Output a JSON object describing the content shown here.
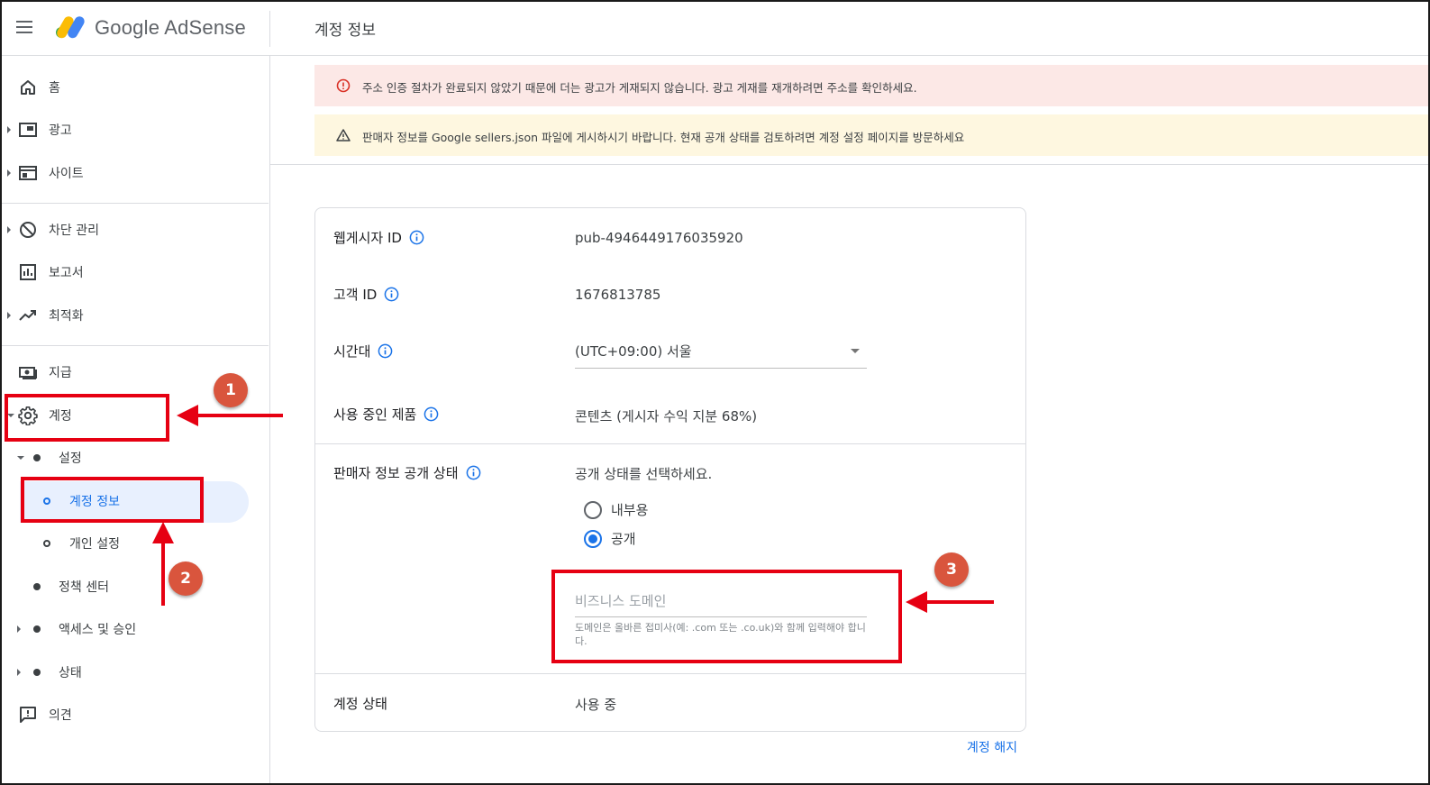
{
  "app": {
    "brand": "Google AdSense",
    "page_title": "계정 정보"
  },
  "sidebar": {
    "home": "홈",
    "ads": "광고",
    "sites": "사이트",
    "blocking": "차단 관리",
    "reports": "보고서",
    "optimization": "최적화",
    "payments": "지급",
    "account": "계정",
    "settings": "설정",
    "account_info": "계정 정보",
    "personal_settings": "개인 설정",
    "policy_center": "정책 센터",
    "access_auth": "액세스 및 승인",
    "status": "상태",
    "feedback": "의견"
  },
  "banners": {
    "error": "주소 인증 절차가 완료되지 않았기 때문에 더는 광고가 게재되지 않습니다. 광고 게재를 재개하려면 주소를 확인하세요.",
    "warning": "판매자 정보를 Google sellers.json 파일에 게시하시기 바랍니다. 현재 공개 상태를 검토하려면 계정 설정 페이지를 방문하세요"
  },
  "account": {
    "publisher_id_label": "웹게시자 ID",
    "publisher_id": "pub-4946449176035920",
    "customer_id_label": "고객 ID",
    "customer_id": "1676813785",
    "timezone_label": "시간대",
    "timezone": "(UTC+09:00) 서울",
    "products_label": "사용 중인 제품",
    "products": "콘텐츠 (게시자 수익 지분 68%)",
    "seller_visibility_label": "판매자 정보 공개 상태",
    "visibility_prompt": "공개 상태를 선택하세요.",
    "option_internal": "내부용",
    "option_public": "공개",
    "selected_option": "공개",
    "domain_placeholder": "비즈니스 도메인",
    "domain_hint": "도메인은 올바른 접미사(예: .com 또는 .co.uk)와 함께 입력해야 합니다.",
    "status_label": "계정 상태",
    "status": "사용 중",
    "terminate_link": "계정 해지"
  },
  "annotations": {
    "badge1": "1",
    "badge2": "2",
    "badge3": "3",
    "color": "#e60012",
    "badge_color": "#d9553d"
  },
  "colors": {
    "accent": "#1a73e8",
    "error_bg": "#fce8e6",
    "warning_bg": "#fef7e0",
    "active_bg": "#e8f0fe"
  }
}
